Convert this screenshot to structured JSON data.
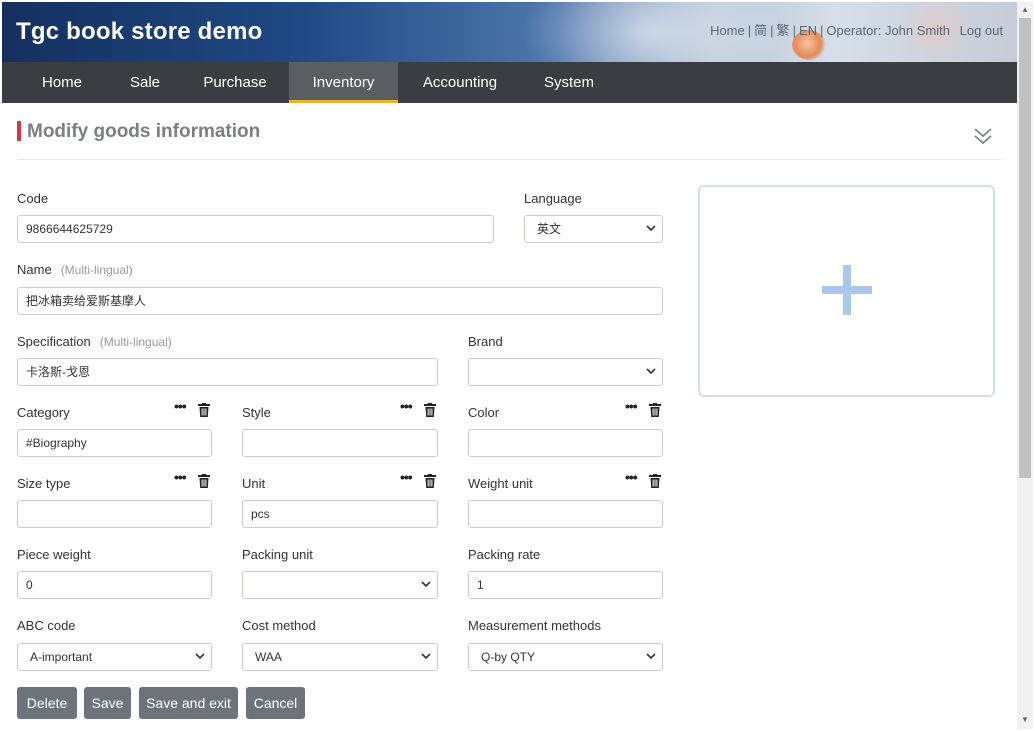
{
  "header": {
    "site_title": "Tgc book store demo",
    "links": {
      "home": "Home",
      "simplified": "简",
      "traditional": "繁",
      "english": "EN",
      "operator_label": "Operator:",
      "operator_name": "John Smith",
      "logout": "Log out"
    }
  },
  "nav": {
    "items": [
      {
        "label": "Home"
      },
      {
        "label": "Sale"
      },
      {
        "label": "Purchase"
      },
      {
        "label": "Inventory",
        "active": true
      },
      {
        "label": "Accounting"
      },
      {
        "label": "System"
      }
    ],
    "active_color": "#f0b429"
  },
  "page": {
    "title": "Modify goods information",
    "accent_color": "#d63843"
  },
  "form": {
    "code": {
      "label": "Code",
      "value": "9866644625729"
    },
    "language": {
      "label": "Language",
      "value": "英文"
    },
    "name": {
      "label": "Name",
      "hint": "(Multi-lingual)",
      "value": "把冰箱卖给爱斯基摩人"
    },
    "specification": {
      "label": "Specification",
      "hint": "(Multi-lingual)",
      "value": "卡洛斯-戈恩"
    },
    "brand": {
      "label": "Brand",
      "value": ""
    },
    "category": {
      "label": "Category",
      "value": "#Biography"
    },
    "style": {
      "label": "Style",
      "value": ""
    },
    "color": {
      "label": "Color",
      "value": ""
    },
    "size_type": {
      "label": "Size type",
      "value": ""
    },
    "unit": {
      "label": "Unit",
      "value": "pcs"
    },
    "weight_unit": {
      "label": "Weight unit",
      "value": ""
    },
    "piece_weight": {
      "label": "Piece weight",
      "value": "0"
    },
    "packing_unit": {
      "label": "Packing unit",
      "value": ""
    },
    "packing_rate": {
      "label": "Packing rate",
      "value": "1"
    },
    "abc_code": {
      "label": "ABC code",
      "value": "A-important"
    },
    "cost_method": {
      "label": "Cost method",
      "value": "WAA"
    },
    "measurement_methods": {
      "label": "Measurement methods",
      "value": "Q-by QTY"
    }
  },
  "buttons": {
    "delete": "Delete",
    "save": "Save",
    "save_exit": "Save and exit",
    "cancel": "Cancel"
  },
  "icons": {
    "more": "more-dots-icon",
    "delete": "trash-icon",
    "collapse": "double-chevron-down-icon",
    "upload": "plus-icon",
    "select": "chevron-down-icon"
  }
}
